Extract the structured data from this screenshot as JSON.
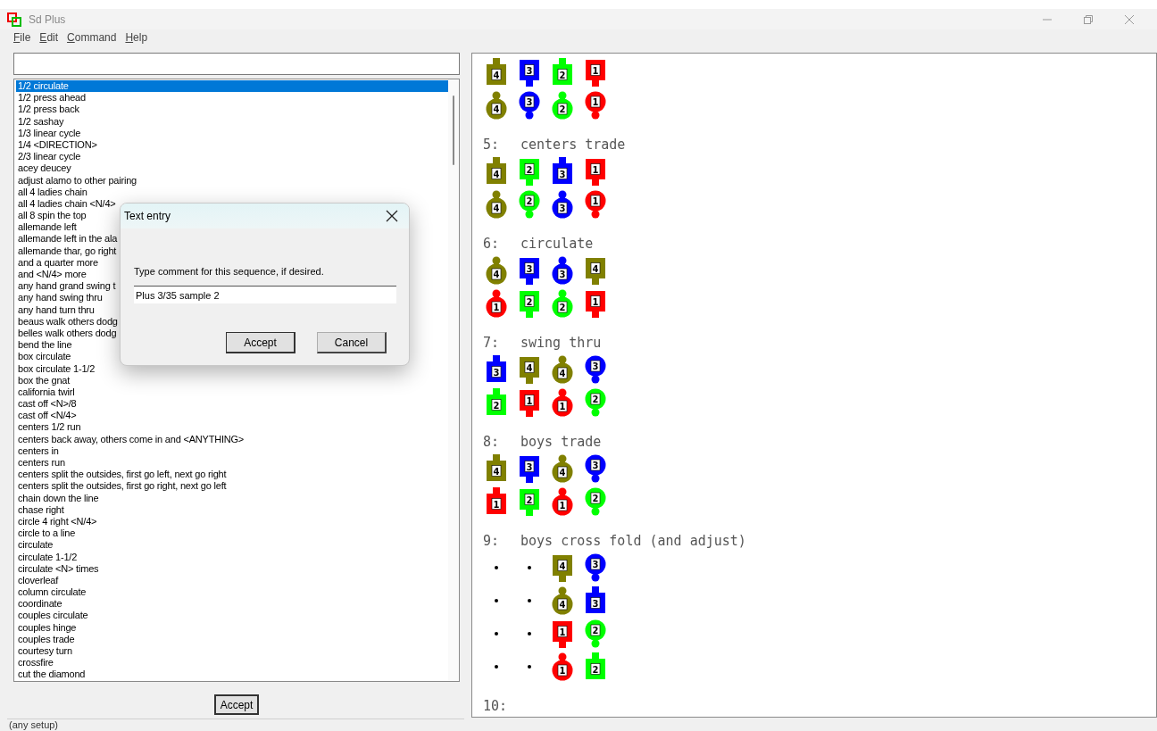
{
  "window": {
    "title": "Sd Plus"
  },
  "menu": [
    {
      "label": "File"
    },
    {
      "label": "Edit"
    },
    {
      "label": "Command"
    },
    {
      "label": "Help"
    }
  ],
  "calls": [
    {
      "label": "1/2 circulate",
      "selected": true
    },
    {
      "label": "1/2 press ahead",
      "selected": false
    },
    {
      "label": "1/2 press back",
      "selected": false
    },
    {
      "label": "1/2 sashay",
      "selected": false
    },
    {
      "label": "1/3 linear cycle",
      "selected": false
    },
    {
      "label": "1/4 <DIRECTION>",
      "selected": false
    },
    {
      "label": "2/3 linear cycle",
      "selected": false
    },
    {
      "label": "acey deucey",
      "selected": false
    },
    {
      "label": "adjust alamo to other pairing",
      "selected": false
    },
    {
      "label": "all 4 ladies chain",
      "selected": false
    },
    {
      "label": "all 4 ladies chain <N/4>",
      "selected": false
    },
    {
      "label": "all 8 spin the top",
      "selected": false
    },
    {
      "label": "allemande left",
      "selected": false
    },
    {
      "label": "allemande left in the ala",
      "selected": false
    },
    {
      "label": "allemande thar, go right",
      "selected": false
    },
    {
      "label": "and a quarter more",
      "selected": false
    },
    {
      "label": "and <N/4> more",
      "selected": false
    },
    {
      "label": "any hand grand swing t",
      "selected": false
    },
    {
      "label": "any hand swing thru",
      "selected": false
    },
    {
      "label": "any hand turn thru",
      "selected": false
    },
    {
      "label": "beaus walk others dodg",
      "selected": false
    },
    {
      "label": "belles walk others dodg",
      "selected": false
    },
    {
      "label": "bend the line",
      "selected": false
    },
    {
      "label": "box circulate",
      "selected": false
    },
    {
      "label": "box circulate 1-1/2",
      "selected": false
    },
    {
      "label": "box the gnat",
      "selected": false
    },
    {
      "label": "california twirl",
      "selected": false
    },
    {
      "label": "cast off <N>/8",
      "selected": false
    },
    {
      "label": "cast off <N/4>",
      "selected": false
    },
    {
      "label": "centers 1/2 run",
      "selected": false
    },
    {
      "label": "centers back away, others come in and <ANYTHING>",
      "selected": false
    },
    {
      "label": "centers in",
      "selected": false
    },
    {
      "label": "centers run",
      "selected": false
    },
    {
      "label": "centers split the outsides, first go left, next go right",
      "selected": false
    },
    {
      "label": "centers split the outsides, first go right, next go left",
      "selected": false
    },
    {
      "label": "chain down the line",
      "selected": false
    },
    {
      "label": "chase right",
      "selected": false
    },
    {
      "label": "circle 4 right <N/4>",
      "selected": false
    },
    {
      "label": "circle to a line",
      "selected": false
    },
    {
      "label": "circulate",
      "selected": false
    },
    {
      "label": "circulate 1-1/2",
      "selected": false
    },
    {
      "label": "circulate <N> times",
      "selected": false
    },
    {
      "label": "cloverleaf",
      "selected": false
    },
    {
      "label": "column circulate",
      "selected": false
    },
    {
      "label": "coordinate",
      "selected": false
    },
    {
      "label": "couples circulate",
      "selected": false
    },
    {
      "label": "couples hinge",
      "selected": false
    },
    {
      "label": "couples trade",
      "selected": false
    },
    {
      "label": "courtesy turn",
      "selected": false
    },
    {
      "label": "crossfire",
      "selected": false
    },
    {
      "label": "cut the diamond",
      "selected": false
    }
  ],
  "accept_button": "Accept",
  "status_bar": "(any setup)",
  "sequence": {
    "top_formation": [
      [
        {
          "kind": "boy",
          "number": "4",
          "faces_up": true,
          "color": "#808000"
        },
        {
          "kind": "boy",
          "number": "3",
          "faces_up": false,
          "color": "#0000ff"
        },
        {
          "kind": "boy",
          "number": "2",
          "faces_up": true,
          "color": "#00ff00"
        },
        {
          "kind": "boy",
          "number": "1",
          "faces_up": false,
          "color": "#ff0000"
        }
      ],
      [
        {
          "kind": "girl",
          "number": "4",
          "faces_up": true,
          "color": "#808000"
        },
        {
          "kind": "girl",
          "number": "3",
          "faces_up": false,
          "color": "#0000ff"
        },
        {
          "kind": "girl",
          "number": "2",
          "faces_up": true,
          "color": "#00ff00"
        },
        {
          "kind": "girl",
          "number": "1",
          "faces_up": false,
          "color": "#ff0000"
        }
      ]
    ],
    "steps": [
      {
        "number": "5:",
        "call": "centers trade",
        "rows": [
          [
            {
              "kind": "boy",
              "number": "4",
              "faces_up": true,
              "color": "#808000"
            },
            {
              "kind": "boy",
              "number": "2",
              "faces_up": false,
              "color": "#00ff00"
            },
            {
              "kind": "boy",
              "number": "3",
              "faces_up": true,
              "color": "#0000ff"
            },
            {
              "kind": "boy",
              "number": "1",
              "faces_up": false,
              "color": "#ff0000"
            }
          ],
          [
            {
              "kind": "girl",
              "number": "4",
              "faces_up": true,
              "color": "#808000"
            },
            {
              "kind": "girl",
              "number": "2",
              "faces_up": false,
              "color": "#00ff00"
            },
            {
              "kind": "girl",
              "number": "3",
              "faces_up": true,
              "color": "#0000ff"
            },
            {
              "kind": "girl",
              "number": "1",
              "faces_up": false,
              "color": "#ff0000"
            }
          ]
        ]
      },
      {
        "number": "6:",
        "call": "circulate",
        "rows": [
          [
            {
              "kind": "girl",
              "number": "4",
              "faces_up": true,
              "color": "#808000"
            },
            {
              "kind": "boy",
              "number": "3",
              "faces_up": false,
              "color": "#0000ff"
            },
            {
              "kind": "girl",
              "number": "3",
              "faces_up": true,
              "color": "#0000ff"
            },
            {
              "kind": "boy",
              "number": "4",
              "faces_up": false,
              "color": "#808000"
            }
          ],
          [
            {
              "kind": "girl",
              "number": "1",
              "faces_up": true,
              "color": "#ff0000"
            },
            {
              "kind": "boy",
              "number": "2",
              "faces_up": false,
              "color": "#00ff00"
            },
            {
              "kind": "girl",
              "number": "2",
              "faces_up": true,
              "color": "#00ff00"
            },
            {
              "kind": "boy",
              "number": "1",
              "faces_up": false,
              "color": "#ff0000"
            }
          ]
        ]
      },
      {
        "number": "7:",
        "call": "swing thru",
        "rows": [
          [
            {
              "kind": "boy",
              "number": "3",
              "faces_up": true,
              "color": "#0000ff"
            },
            {
              "kind": "boy",
              "number": "4",
              "faces_up": false,
              "color": "#808000"
            },
            {
              "kind": "girl",
              "number": "4",
              "faces_up": true,
              "color": "#808000"
            },
            {
              "kind": "girl",
              "number": "3",
              "faces_up": false,
              "color": "#0000ff"
            }
          ],
          [
            {
              "kind": "boy",
              "number": "2",
              "faces_up": true,
              "color": "#00ff00"
            },
            {
              "kind": "boy",
              "number": "1",
              "faces_up": false,
              "color": "#ff0000"
            },
            {
              "kind": "girl",
              "number": "1",
              "faces_up": true,
              "color": "#ff0000"
            },
            {
              "kind": "girl",
              "number": "2",
              "faces_up": false,
              "color": "#00ff00"
            }
          ]
        ]
      },
      {
        "number": "8:",
        "call": "boys trade",
        "rows": [
          [
            {
              "kind": "boy",
              "number": "4",
              "faces_up": true,
              "color": "#808000"
            },
            {
              "kind": "boy",
              "number": "3",
              "faces_up": false,
              "color": "#0000ff"
            },
            {
              "kind": "girl",
              "number": "4",
              "faces_up": true,
              "color": "#808000"
            },
            {
              "kind": "girl",
              "number": "3",
              "faces_up": false,
              "color": "#0000ff"
            }
          ],
          [
            {
              "kind": "boy",
              "number": "1",
              "faces_up": true,
              "color": "#ff0000"
            },
            {
              "kind": "boy",
              "number": "2",
              "faces_up": false,
              "color": "#00ff00"
            },
            {
              "kind": "girl",
              "number": "1",
              "faces_up": true,
              "color": "#ff0000"
            },
            {
              "kind": "girl",
              "number": "2",
              "faces_up": false,
              "color": "#00ff00"
            }
          ]
        ]
      },
      {
        "number": "9:",
        "call": "boys cross fold (and adjust)",
        "rows": [
          [
            {
              "kind": "empty"
            },
            {
              "kind": "empty"
            },
            {
              "kind": "boy",
              "number": "4",
              "faces_up": false,
              "color": "#808000"
            },
            {
              "kind": "girl",
              "number": "3",
              "faces_up": false,
              "color": "#0000ff"
            }
          ],
          [
            {
              "kind": "empty"
            },
            {
              "kind": "empty"
            },
            {
              "kind": "girl",
              "number": "4",
              "faces_up": true,
              "color": "#808000"
            },
            {
              "kind": "boy",
              "number": "3",
              "faces_up": true,
              "color": "#0000ff"
            }
          ],
          [
            {
              "kind": "empty"
            },
            {
              "kind": "empty"
            },
            {
              "kind": "boy",
              "number": "1",
              "faces_up": false,
              "color": "#ff0000"
            },
            {
              "kind": "girl",
              "number": "2",
              "faces_up": false,
              "color": "#00ff00"
            }
          ],
          [
            {
              "kind": "empty"
            },
            {
              "kind": "empty"
            },
            {
              "kind": "girl",
              "number": "1",
              "faces_up": true,
              "color": "#ff0000"
            },
            {
              "kind": "boy",
              "number": "2",
              "faces_up": true,
              "color": "#00ff00"
            }
          ]
        ]
      },
      {
        "number": "10:"
      }
    ]
  },
  "dialog": {
    "title": "Text entry",
    "prompt": "Type comment for this sequence, if desired.",
    "value": "Plus 3/35 sample 2",
    "buttons": [
      {
        "label": "Accept",
        "default": true
      },
      {
        "label": "Cancel",
        "default": false
      }
    ]
  }
}
